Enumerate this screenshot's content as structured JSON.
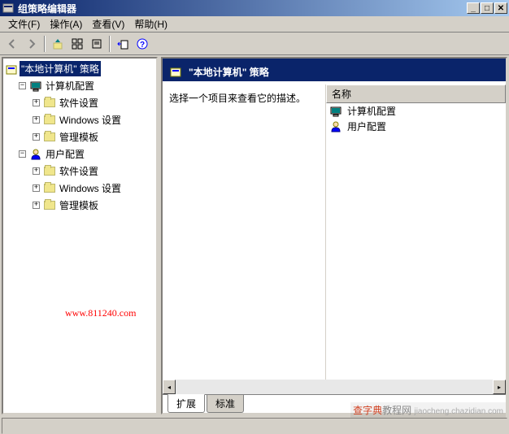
{
  "titlebar": {
    "title": "组策略编辑器"
  },
  "menubar": {
    "file": "文件(F)",
    "action": "操作(A)",
    "view": "查看(V)",
    "help": "帮助(H)"
  },
  "toolbar": {
    "back": "←",
    "forward": "→",
    "up": "⬆",
    "props": "▦",
    "refresh": "▢",
    "export": "↪",
    "help": "?"
  },
  "tree": {
    "root": "\"本地计算机\" 策略",
    "computer": "计算机配置",
    "user": "用户配置",
    "software": "软件设置",
    "windows": "Windows 设置",
    "admin": "管理模板"
  },
  "content": {
    "header": "\"本地计算机\" 策略",
    "desc": "选择一个项目来查看它的描述。",
    "list_header": "名称",
    "item_computer": "计算机配置",
    "item_user": "用户配置"
  },
  "tabs": {
    "extended": "扩展",
    "standard": "标准"
  },
  "watermark": {
    "url": "www.811240.com",
    "wm2_a": "查字典",
    "wm2_b": "教程网",
    "wm2_c": "jiaocheng.chazidian.com"
  }
}
